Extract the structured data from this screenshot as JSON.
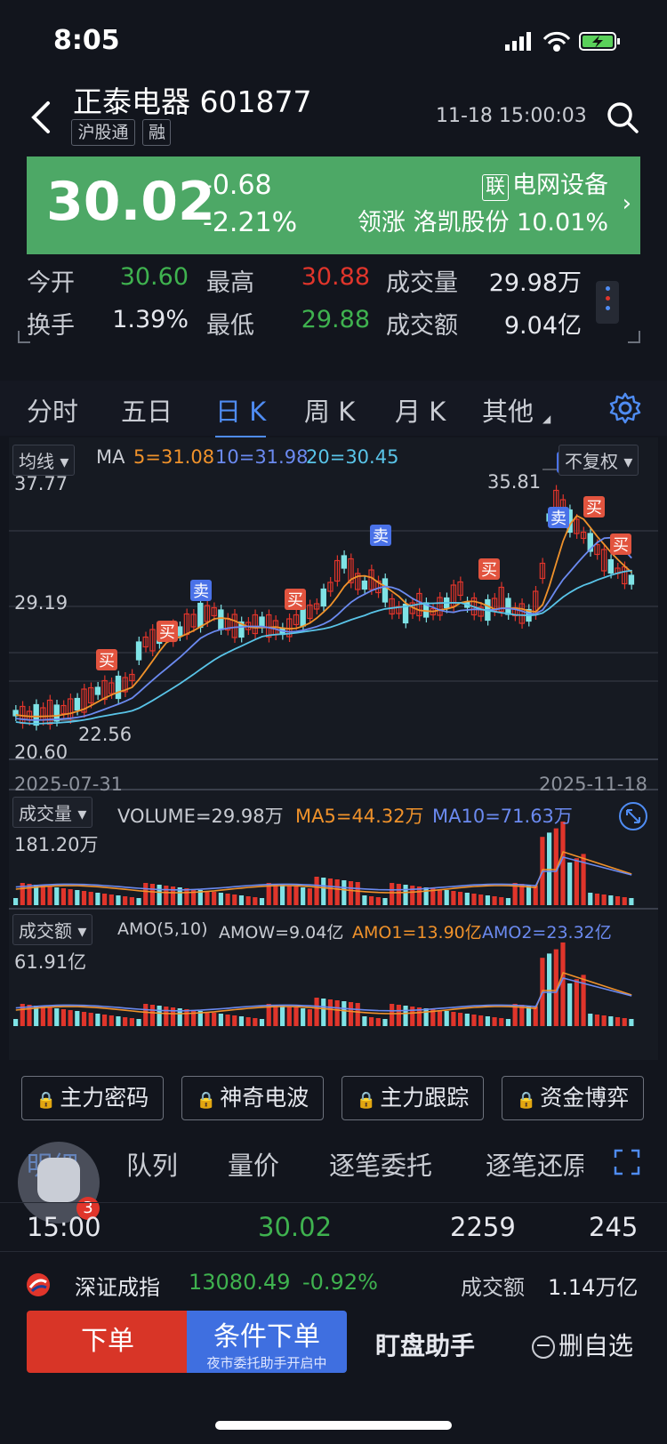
{
  "status_bar": {
    "time": "8:05"
  },
  "header": {
    "stock_name": "正泰电器 601877",
    "tags": [
      "沪股通",
      "融"
    ],
    "datetime": "11-18 15:00:03"
  },
  "price_box": {
    "price": "30.02",
    "change": "-0.68",
    "change_pct": "-2.21%",
    "sector_badge": "联",
    "sector": "电网设备",
    "leader": "领涨 洛凯股份 10.01%"
  },
  "stats": {
    "open_label": "今开",
    "open": "30.60",
    "high_label": "最高",
    "high": "30.88",
    "volume_label": "成交量",
    "volume": "29.98万",
    "turnover_label": "换手",
    "turnover": "1.39%",
    "low_label": "最低",
    "low": "29.88",
    "amount_label": "成交额",
    "amount": "9.04亿"
  },
  "k_tabs": [
    "分时",
    "五日",
    "日 K",
    "周 K",
    "月 K",
    "其他"
  ],
  "main_chart": {
    "indicator_dropdown": "均线",
    "ma_label": "MA",
    "ma5": "5=31.08",
    "ma10": "10=31.98",
    "ma20": "20=30.45",
    "adjust_dropdown": "不复权",
    "y_top": "37.77",
    "y_mid": "29.19",
    "y_bottom": "20.60",
    "peak_label": "35.81",
    "low_label": "22.56",
    "date_start": "2025-07-31",
    "date_end": "2025-11-18",
    "buy_label": "买",
    "sell_label": "卖"
  },
  "volume_chart": {
    "dropdown": "成交量",
    "volume": "VOLUME=29.98万",
    "ma5": "MA5=44.32万",
    "ma10": "MA10=71.63万",
    "y_top": "181.20万"
  },
  "amount_chart": {
    "dropdown": "成交额",
    "params": "AMO(5,10)",
    "amow": "AMOW=9.04亿",
    "amo1": "AMO1=13.90亿",
    "amo2": "AMO2=23.32亿",
    "y_top": "61.91亿"
  },
  "lock_buttons": [
    "主力密码",
    "神奇电波",
    "主力跟踪",
    "资金博弈"
  ],
  "bottom_tabs": [
    "明细",
    "队列",
    "量价",
    "逐笔委托",
    "逐笔还原"
  ],
  "trade_row": {
    "time": "15:00",
    "price": "30.02",
    "volume": "2259",
    "count": "245"
  },
  "avatar_badge": "3",
  "index_bar": {
    "name": "深证成指",
    "value": "13080.49",
    "change": "-0.92%",
    "amount_label": "成交额",
    "amount": "1.14万亿"
  },
  "actions": {
    "order": "下单",
    "conditional": "条件下单",
    "conditional_sub": "夜市委托助手开启中",
    "assistant": "盯盘助手",
    "remove": "删自选"
  },
  "colors": {
    "up": "#e0352b",
    "down": "#3fb24f",
    "accent": "#4f8cf3",
    "ma5": "#f0922b",
    "ma10": "#6b8af0",
    "ma20": "#59c4e8",
    "cyan_candle": "#7fe3e6"
  }
}
